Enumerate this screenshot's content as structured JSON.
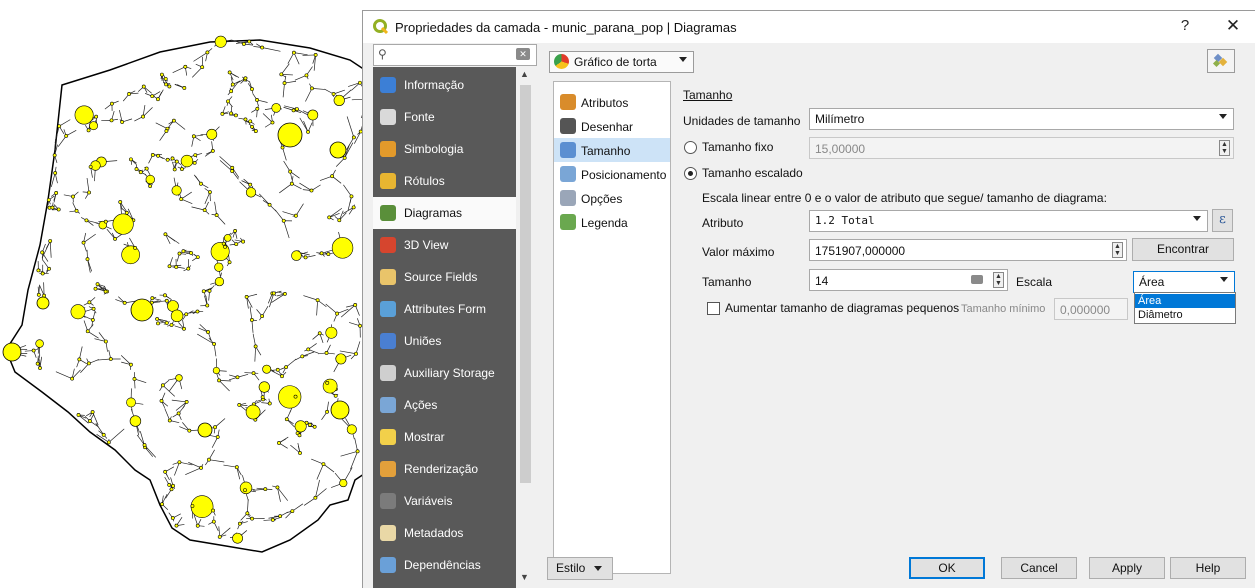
{
  "map": {
    "background": "#ffffff",
    "circle_fill": "#ffff00",
    "outline": "#000000"
  },
  "dialog": {
    "title": "Propriedades da camada - munic_parana_pop | Diagramas",
    "help_glyph": "?",
    "close_glyph": "✕",
    "search_placeholder": "",
    "nav": [
      {
        "label": "Informação",
        "icon": "info-icon",
        "color": "#3c7fd6"
      },
      {
        "label": "Fonte",
        "icon": "source-icon",
        "color": "#d9d9d9"
      },
      {
        "label": "Simbologia",
        "icon": "symbology-icon",
        "color": "#e39a2b"
      },
      {
        "label": "Rótulos",
        "icon": "labels-icon",
        "color": "#e8b531"
      },
      {
        "label": "Diagramas",
        "icon": "diagrams-icon",
        "color": "#5a8f3a"
      },
      {
        "label": "3D View",
        "icon": "3d-icon",
        "color": "#d6452e"
      },
      {
        "label": "Source Fields",
        "icon": "fields-icon",
        "color": "#e9c46a"
      },
      {
        "label": "Attributes Form",
        "icon": "form-icon",
        "color": "#5aa0d8"
      },
      {
        "label": "Uniões",
        "icon": "joins-icon",
        "color": "#4a7fd1"
      },
      {
        "label": "Auxiliary Storage",
        "icon": "storage-icon",
        "color": "#cfcfcf"
      },
      {
        "label": "Ações",
        "icon": "actions-icon",
        "color": "#7aa6d6"
      },
      {
        "label": "Mostrar",
        "icon": "display-icon",
        "color": "#f2d04a"
      },
      {
        "label": "Renderização",
        "icon": "rendering-icon",
        "color": "#e3a03b"
      },
      {
        "label": "Variáveis",
        "icon": "variables-icon",
        "color": "#7b7b7b"
      },
      {
        "label": "Metadados",
        "icon": "metadata-icon",
        "color": "#e9d8a6"
      },
      {
        "label": "Dependências",
        "icon": "dependencies-icon",
        "color": "#6aa0d8"
      }
    ],
    "selected_nav": "Diagramas",
    "diagram_type": "Gráfico de torta",
    "subtabs": [
      {
        "label": "Atributos",
        "icon": "attributes-icon"
      },
      {
        "label": "Desenhar",
        "icon": "draw-icon"
      },
      {
        "label": "Tamanho",
        "icon": "size-icon"
      },
      {
        "label": "Posicionamento",
        "icon": "placement-icon"
      },
      {
        "label": "Opções",
        "icon": "options-icon"
      },
      {
        "label": "Legenda",
        "icon": "legend-icon"
      }
    ],
    "selected_subtab": "Tamanho",
    "form": {
      "section_title": "Tamanho",
      "units_label": "Unidades de tamanho",
      "units_value": "Milímetro",
      "fixed_label": "Tamanho fixo",
      "fixed_value": "15,00000",
      "scaled_label": "Tamanho escalado",
      "scale_description": "Escala linear entre 0 e o valor de atributo que segue/ tamanho de diagrama:",
      "attribute_label": "Atributo",
      "attribute_value": "1.2 Total",
      "expression_glyph": "ε",
      "max_label": "Valor máximo",
      "max_value": "1751907,000000",
      "find_button": "Encontrar",
      "size_label": "Tamanho",
      "size_value": "14",
      "scale_label": "Escala",
      "scale_value": "Área",
      "scale_options": [
        "Área",
        "Diâmetro"
      ],
      "increase_label": "Aumentar tamanho de diagramas pequenos",
      "min_size_label": "Tamanho mínimo",
      "min_size_value": "0,000000"
    },
    "footer": {
      "style_button": "Estilo",
      "ok": "OK",
      "cancel": "Cancel",
      "apply": "Apply",
      "help": "Help"
    }
  }
}
